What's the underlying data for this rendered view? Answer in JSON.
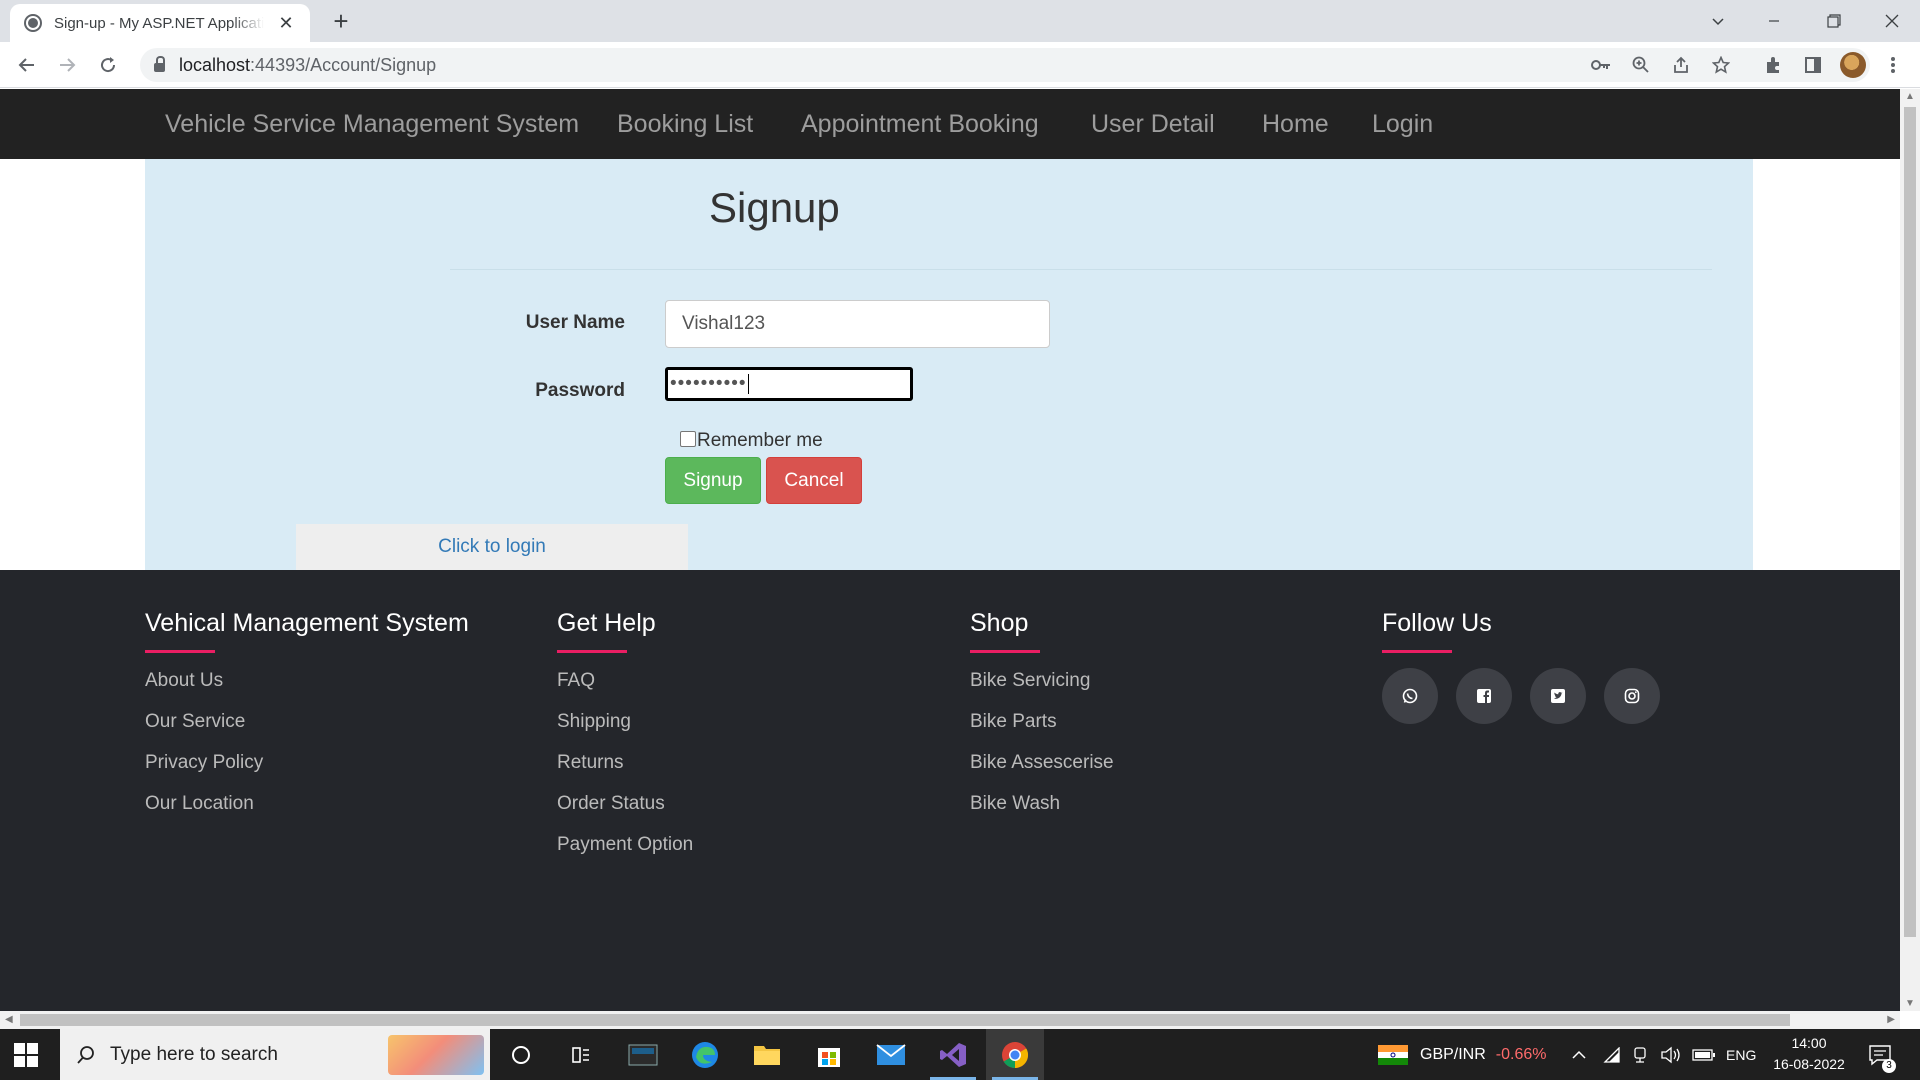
{
  "browser": {
    "tab_title": "Sign-up - My ASP.NET Application",
    "url_host": "localhost",
    "url_rest": ":44393/Account/Signup"
  },
  "nav": {
    "brand": "Vehicle Service Management System",
    "items": [
      "Booking List",
      "Appointment Booking",
      "User Detail",
      "Home",
      "Login"
    ]
  },
  "form": {
    "title": "Signup",
    "username_label": "User Name",
    "username_value": "Vishal123",
    "password_label": "Password",
    "password_masked": "••••••••••",
    "remember_label": "Remember me",
    "remember_checked": false,
    "signup_button": "Signup",
    "cancel_button": "Cancel",
    "login_link": "Click to login"
  },
  "footer": {
    "columns": [
      {
        "heading": "Vehical Management System",
        "links": [
          "About Us",
          "Our Service",
          "Privacy Policy",
          "Our Location"
        ]
      },
      {
        "heading": "Get Help",
        "links": [
          "FAQ",
          "Shipping",
          "Returns",
          "Order Status",
          "Payment Option"
        ]
      },
      {
        "heading": "Shop",
        "links": [
          "Bike Servicing",
          "Bike Parts",
          "Bike Assescerise",
          "Bike Wash"
        ]
      },
      {
        "heading": "Follow Us",
        "links": []
      }
    ],
    "social_icons": [
      "whatsapp-icon",
      "facebook-icon",
      "twitter-icon",
      "instagram-icon"
    ],
    "accent_color": "#e91e63"
  },
  "taskbar": {
    "search_placeholder": "Type here to search",
    "ticker_label": "GBP/INR",
    "ticker_change": "-0.66%",
    "language": "ENG",
    "time": "14:00",
    "date": "16-08-2022",
    "notification_count": "3"
  },
  "colors": {
    "navbar": "#222222",
    "panel": "#d9ebf5",
    "success": "#5cb85c",
    "danger": "#d9534f",
    "link": "#337ab7"
  }
}
